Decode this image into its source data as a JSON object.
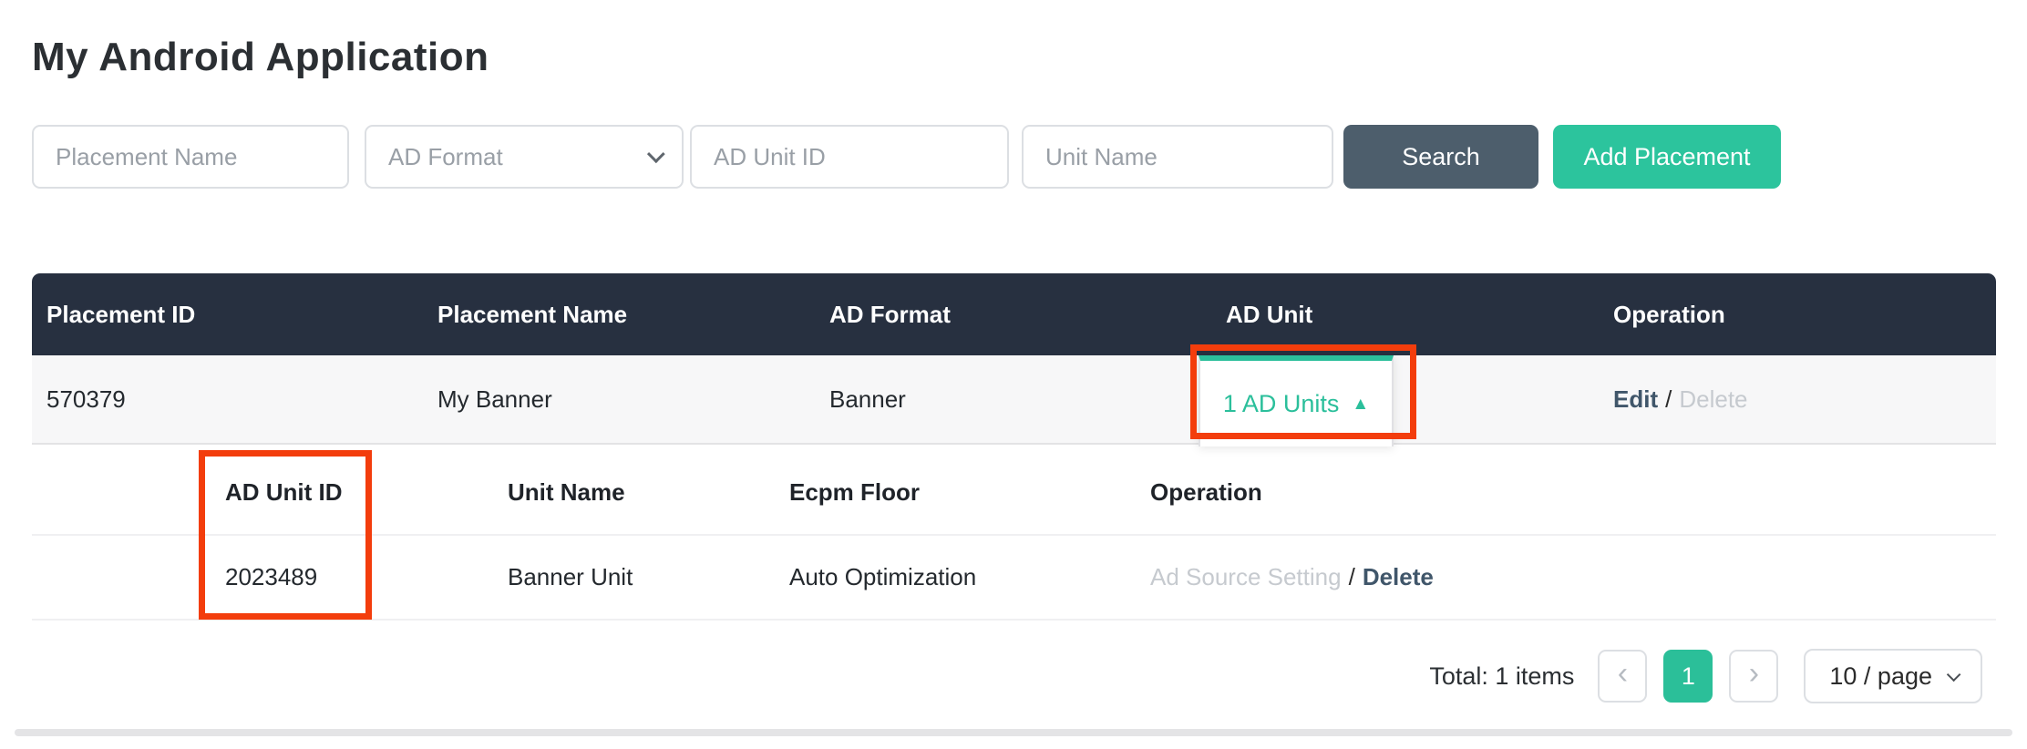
{
  "app": {
    "title": "My Android Application"
  },
  "filters": {
    "placement_name": {
      "placeholder": "Placement Name",
      "value": ""
    },
    "ad_format": {
      "label": "AD Format"
    },
    "ad_unit_id": {
      "placeholder": "AD Unit ID",
      "value": ""
    },
    "unit_name": {
      "placeholder": "Unit Name",
      "value": ""
    },
    "search_label": "Search",
    "add_placement_label": "Add Placement"
  },
  "table": {
    "headers": [
      "Placement ID",
      "Placement Name",
      "AD Format",
      "AD Unit",
      "Operation"
    ],
    "row": {
      "placement_id": "570379",
      "placement_name": "My Banner",
      "ad_format": "Banner",
      "ad_unit_toggle": "1 AD Units",
      "edit_label": "Edit",
      "op_separator": "/",
      "delete_label": "Delete"
    },
    "subtable": {
      "headers": [
        "AD Unit ID",
        "Unit Name",
        "Ecpm Floor",
        "Operation"
      ],
      "row": {
        "ad_unit_id": "2023489",
        "unit_name": "Banner Unit",
        "ecpm_floor": "Auto Optimization",
        "ad_source_setting_label": "Ad Source Setting",
        "op_separator": "/",
        "delete_label": "Delete"
      }
    }
  },
  "pagination": {
    "total_label": "Total: 1 items",
    "current_page": "1",
    "page_size_label": "10 / page"
  },
  "icons": {
    "caret_up": "▲",
    "chevron_prev": "‹",
    "chevron_next": "›"
  },
  "colors": {
    "accent_green": "#2bc19b",
    "header_dark": "#273040",
    "search_button": "#4d5e6c",
    "annotation_red": "#f33d0c",
    "row_background": "#f7f7f8"
  }
}
